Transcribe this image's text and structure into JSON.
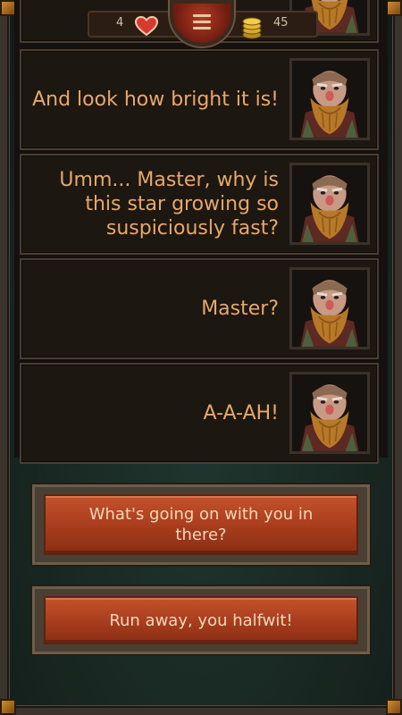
{
  "hud": {
    "lives": "4",
    "gold": "45",
    "heart_icon": "heart-icon",
    "coin_icon": "gold-coins-icon",
    "menu_icon": "hamburger-menu-icon"
  },
  "dialog": [
    {
      "text": "And look how bright it is!"
    },
    {
      "text": "Umm... Master, why is this star growing so suspiciously fast?"
    },
    {
      "text": "Master?"
    },
    {
      "text": "A-A-AH!"
    }
  ],
  "choices": [
    {
      "label": "What's going on with you in there?"
    },
    {
      "label": "Run away, you halfwit!"
    }
  ],
  "colors": {
    "dialog_text": "#e6a86a",
    "choice_button": "#b4462a",
    "background": "#1b2b27"
  }
}
